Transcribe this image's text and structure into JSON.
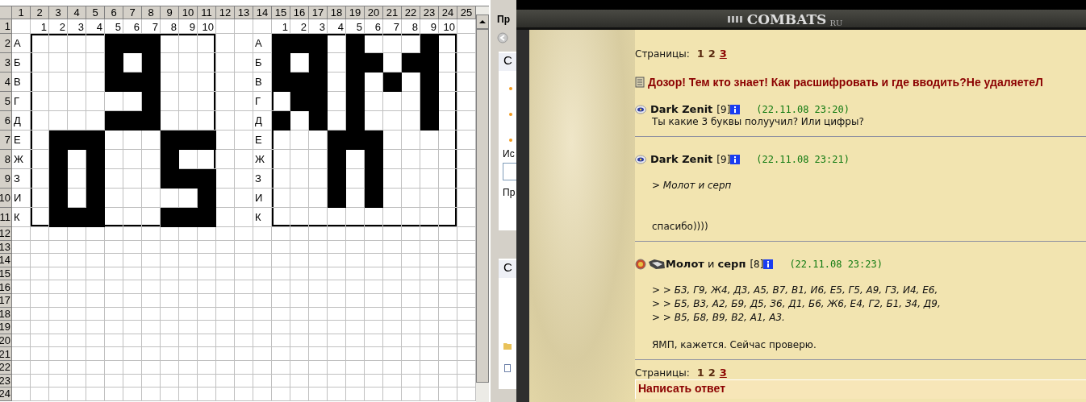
{
  "spreadsheet": {
    "column_headers": [
      "1",
      "2",
      "3",
      "4",
      "5",
      "6",
      "7",
      "8",
      "9",
      "10",
      "11",
      "12",
      "13",
      "14",
      "15",
      "16",
      "17",
      "18",
      "19",
      "20",
      "21",
      "22",
      "23",
      "24",
      "25"
    ],
    "row_headers": [
      "1",
      "2",
      "3",
      "4",
      "5",
      "6",
      "7",
      "8",
      "9",
      "10",
      "11",
      "12",
      "13",
      "14",
      "15",
      "16",
      "17",
      "18",
      "19",
      "20",
      "21",
      "22",
      "23",
      "24"
    ],
    "grids": [
      {
        "col_numbers": [
          "1",
          "2",
          "3",
          "4",
          "5",
          "6",
          "7",
          "8",
          "9",
          "10"
        ],
        "rows": [
          {
            "letter": "А",
            "cells": [
              false,
              false,
              false,
              false,
              true,
              true,
              true,
              false,
              false,
              false
            ]
          },
          {
            "letter": "Б",
            "cells": [
              false,
              false,
              false,
              false,
              true,
              false,
              true,
              false,
              false,
              false
            ]
          },
          {
            "letter": "В",
            "cells": [
              false,
              false,
              false,
              false,
              true,
              true,
              true,
              false,
              false,
              false
            ]
          },
          {
            "letter": "Г",
            "cells": [
              false,
              false,
              false,
              false,
              false,
              false,
              true,
              false,
              false,
              false
            ]
          },
          {
            "letter": "Д",
            "cells": [
              false,
              false,
              false,
              false,
              true,
              true,
              true,
              false,
              false,
              false
            ]
          },
          {
            "letter": "Е",
            "cells": [
              false,
              true,
              true,
              true,
              false,
              false,
              false,
              true,
              true,
              true
            ]
          },
          {
            "letter": "Ж",
            "cells": [
              false,
              true,
              false,
              true,
              false,
              false,
              false,
              true,
              false,
              false
            ]
          },
          {
            "letter": "З",
            "cells": [
              false,
              true,
              false,
              true,
              false,
              false,
              false,
              true,
              true,
              true
            ]
          },
          {
            "letter": "И",
            "cells": [
              false,
              true,
              false,
              true,
              false,
              false,
              false,
              false,
              false,
              true
            ]
          },
          {
            "letter": "К",
            "cells": [
              false,
              true,
              true,
              true,
              false,
              false,
              false,
              true,
              true,
              true
            ]
          }
        ]
      },
      {
        "col_numbers": [
          "1",
          "2",
          "3",
          "4",
          "5",
          "6",
          "7",
          "8",
          "9",
          "10"
        ],
        "rows": [
          {
            "letter": "А",
            "cells": [
              true,
              true,
              true,
              false,
              true,
              false,
              false,
              false,
              true,
              false
            ]
          },
          {
            "letter": "Б",
            "cells": [
              true,
              false,
              true,
              false,
              true,
              true,
              false,
              true,
              true,
              false
            ]
          },
          {
            "letter": "В",
            "cells": [
              true,
              true,
              true,
              false,
              true,
              false,
              true,
              false,
              true,
              false
            ]
          },
          {
            "letter": "Г",
            "cells": [
              false,
              true,
              true,
              false,
              true,
              false,
              false,
              false,
              true,
              false
            ]
          },
          {
            "letter": "Д",
            "cells": [
              true,
              false,
              true,
              false,
              true,
              false,
              false,
              false,
              true,
              false
            ]
          },
          {
            "letter": "Е",
            "cells": [
              false,
              false,
              false,
              true,
              true,
              true,
              false,
              false,
              false,
              false
            ]
          },
          {
            "letter": "Ж",
            "cells": [
              false,
              false,
              false,
              true,
              false,
              true,
              false,
              false,
              false,
              false
            ]
          },
          {
            "letter": "З",
            "cells": [
              false,
              false,
              false,
              true,
              false,
              true,
              false,
              false,
              false,
              false
            ]
          },
          {
            "letter": "И",
            "cells": [
              false,
              false,
              false,
              true,
              false,
              true,
              false,
              false,
              false,
              false
            ]
          },
          {
            "letter": "К",
            "cells": [
              false,
              false,
              false,
              false,
              false,
              false,
              false,
              false,
              false,
              false
            ]
          }
        ]
      }
    ]
  },
  "task_pane": {
    "title": "Пр",
    "section": "С",
    "label": "Ис",
    "label_2": "Пр",
    "section_2": "С"
  },
  "forum": {
    "logo": "COMBATS",
    "logo_suffix": "RU",
    "pages_top": {
      "label": "Страницы:",
      "items": [
        {
          "text": "1",
          "selected": false
        },
        {
          "text": "2",
          "selected": false
        },
        {
          "text": "3",
          "selected": true
        }
      ]
    },
    "topic": "Дозор! Тем кто знает! Как расшифровать и где вводить?Не удаляетеЛ",
    "posts": [
      {
        "author": "**Dark Zenit**",
        "level": "[9]",
        "time": "(22.11.08 23:20)",
        "clan": false,
        "body": [
          {
            "kind": "text",
            "text": "Ты какие 3 буквы полуучил? Или цифры?"
          }
        ]
      },
      {
        "author": "**Dark Zenit**",
        "level": "[9]",
        "time": "(22.11.08 23:21)",
        "clan": false,
        "body": [
          {
            "kind": "gap"
          },
          {
            "kind": "quote",
            "text": "> Молот и серп"
          },
          {
            "kind": "gap"
          },
          {
            "kind": "gap"
          },
          {
            "kind": "text",
            "text": "спасибо))))"
          }
        ]
      },
      {
        "author": "**Молот** и **серп**",
        "level": "[8]",
        "time": "(22.11.08 23:23)",
        "clan": true,
        "body": [
          {
            "kind": "gap"
          },
          {
            "kind": "quote",
            "text": "> > Б3, Г9, Ж4, Д3, А5, В7, В1, И6, Е5, Г5, А9, Г3, И4, Е6,"
          },
          {
            "kind": "quote",
            "text": "> > Б5, В3, А2, Б9, Д5, З6, Д1, Б6, Ж6, Е4, Г2, Б1, З4, Д9,"
          },
          {
            "kind": "quote",
            "text": "> > В5, Б8, В9, В2, А1, А3."
          },
          {
            "kind": "gap"
          },
          {
            "kind": "text",
            "text": "ЯМП, кажется. Сейчас проверю."
          }
        ]
      }
    ],
    "pages_bottom": {
      "label": "Страницы:",
      "items": [
        {
          "text": "1",
          "selected": false
        },
        {
          "text": "2",
          "selected": false
        },
        {
          "text": "3",
          "selected": true
        }
      ]
    },
    "reply": "Написать ответ"
  }
}
